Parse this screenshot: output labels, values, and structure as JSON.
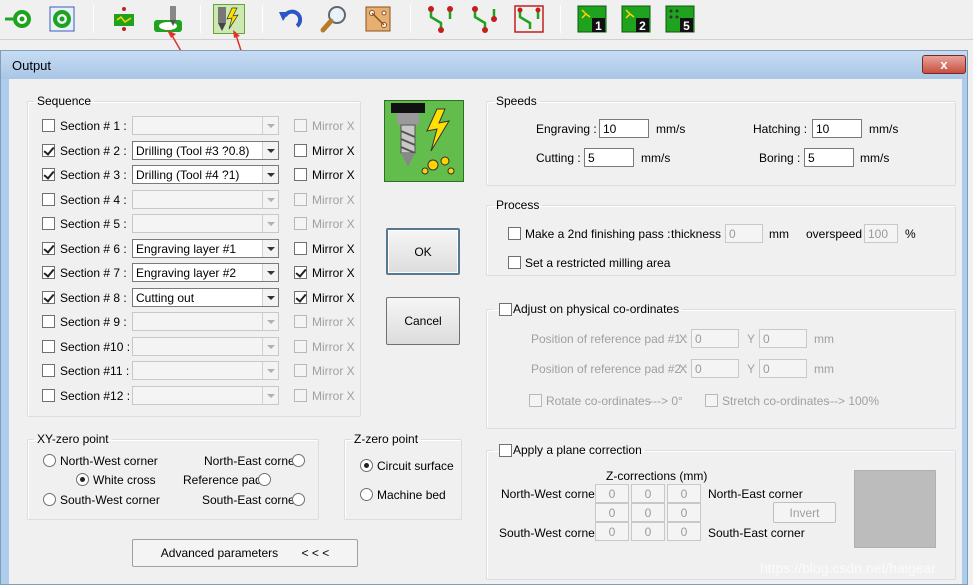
{
  "toolbar": {
    "icons": [
      "target-icon",
      "pad-icon",
      "pcb-icon",
      "engrave-icon",
      "drill-mill-icon",
      "undo-icon",
      "zoom-icon",
      "board-icon",
      "route-icon-1",
      "route-icon-2",
      "route-icon-3",
      "layer-1-icon",
      "layer-2-icon",
      "layer-5-icon"
    ],
    "layer_1": "1",
    "layer_2": "2",
    "layer_5": "5",
    "accent": "#1fa31f",
    "annotation_color": "#e0322a"
  },
  "window": {
    "title": "Output",
    "close": "x"
  },
  "sequence": {
    "legend": "Sequence",
    "rows": [
      {
        "label": "Section #  1 :",
        "checked": false,
        "value": "",
        "enabled": false,
        "mirror": "Mirror X",
        "mirror_checked": false
      },
      {
        "label": "Section #  2 :",
        "checked": true,
        "value": "Drilling (Tool #3 ?0.8)",
        "enabled": true,
        "mirror": "Mirror X",
        "mirror_checked": false
      },
      {
        "label": "Section #  3 :",
        "checked": true,
        "value": "Drilling (Tool #4 ?1)",
        "enabled": true,
        "mirror": "Mirror X",
        "mirror_checked": false
      },
      {
        "label": "Section #  4 :",
        "checked": false,
        "value": "",
        "enabled": false,
        "mirror": "Mirror X",
        "mirror_checked": false
      },
      {
        "label": "Section #  5 :",
        "checked": false,
        "value": "",
        "enabled": false,
        "mirror": "Mirror X",
        "mirror_checked": false
      },
      {
        "label": "Section #  6 :",
        "checked": true,
        "value": "Engraving layer #1",
        "enabled": true,
        "mirror": "Mirror X",
        "mirror_checked": false
      },
      {
        "label": "Section #  7 :",
        "checked": true,
        "value": "Engraving layer #2",
        "enabled": true,
        "mirror": "Mirror X",
        "mirror_checked": true
      },
      {
        "label": "Section #  8 :",
        "checked": true,
        "value": "Cutting out",
        "enabled": true,
        "mirror": "Mirror X",
        "mirror_checked": true
      },
      {
        "label": "Section #  9 :",
        "checked": false,
        "value": "",
        "enabled": false,
        "mirror": "Mirror X",
        "mirror_checked": false
      },
      {
        "label": "Section #10 :",
        "checked": false,
        "value": "",
        "enabled": false,
        "mirror": "Mirror X",
        "mirror_checked": false
      },
      {
        "label": "Section #11 :",
        "checked": false,
        "value": "",
        "enabled": false,
        "mirror": "Mirror X",
        "mirror_checked": false
      },
      {
        "label": "Section #12 :",
        "checked": false,
        "value": "",
        "enabled": false,
        "mirror": "Mirror X",
        "mirror_checked": false
      }
    ]
  },
  "xy_zero": {
    "legend": "XY-zero point",
    "nw": "North-West corner",
    "ne": "North-East corner",
    "white_cross": "White cross",
    "ref_pad": "Reference pad",
    "sw": "South-West corner",
    "se": "South-East corner",
    "selected": "White cross"
  },
  "z_zero": {
    "legend": "Z-zero point",
    "circuit": "Circuit surface",
    "machine": "Machine bed",
    "selected": "Circuit surface"
  },
  "advanced": {
    "label": "Advanced parameters",
    "chevrons": "< < <"
  },
  "buttons": {
    "ok": "OK",
    "cancel": "Cancel"
  },
  "speeds": {
    "legend": "Speeds",
    "engraving_label": "Engraving :",
    "engraving": "10",
    "engraving_unit": "mm/s",
    "hatching_label": "Hatching :",
    "hatching": "10",
    "hatching_unit": "mm/s",
    "cutting_label": "Cutting :",
    "cutting": "5",
    "cutting_unit": "mm/s",
    "boring_label": "Boring :",
    "boring": "5",
    "boring_unit": "mm/s"
  },
  "process": {
    "legend": "Process",
    "finishing": "Make a 2nd finishing pass :",
    "thickness_label": "thickness",
    "thickness": "0",
    "thickness_unit": "mm",
    "overspeed_label": "overspeed",
    "overspeed": "100",
    "overspeed_unit": "%",
    "restricted": "Set a restricted milling area"
  },
  "physical": {
    "legend": "Adjust on physical co-ordinates",
    "pad1": "Position of reference pad #1 :",
    "pad2": "Position of reference pad #2 :",
    "x": "X",
    "y": "Y",
    "unit": "mm",
    "pad1_x": "0",
    "pad1_y": "0",
    "pad2_x": "0",
    "pad2_y": "0",
    "rotate": "Rotate co-ordinates",
    "rotate_val": "---> 0°",
    "stretch": "Stretch co-ordinates",
    "stretch_val": "---> 100%"
  },
  "plane": {
    "legend": "Apply a plane correction",
    "z_label": "Z-corrections (mm)",
    "nw": "North-West corner",
    "ne": "North-East corner",
    "sw": "South-West corner",
    "se": "South-East corner",
    "grid": [
      "0",
      "0",
      "0",
      "0",
      "0",
      "0",
      "0",
      "0",
      "0"
    ],
    "invert": "Invert"
  },
  "watermark": "https://blog.csdn.net/haigear"
}
